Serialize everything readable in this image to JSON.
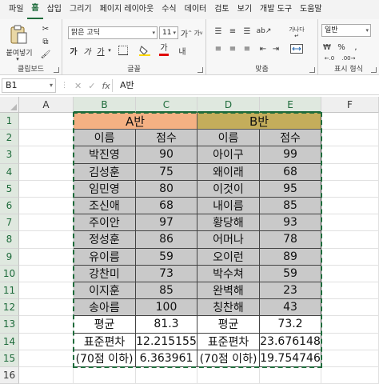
{
  "menu": [
    "파일",
    "홈",
    "삽입",
    "그리기",
    "페이지 레이아웃",
    "수식",
    "데이터",
    "검토",
    "보기",
    "개발 도구",
    "도움말"
  ],
  "menu_active_index": 1,
  "ribbon": {
    "paste_label": "붙여넣기",
    "clipboard_label": "클립보드",
    "font_name": "맑은 고딕",
    "font_size": "11",
    "font_label": "글꼴",
    "align_label": "맞춤",
    "number_format": "일반",
    "number_label": "표시 형식",
    "wrap_label": "가나다",
    "bold": "가",
    "italic": "가",
    "underline": "가",
    "font_color_glyph": "가",
    "grow_font": "가",
    "shrink_font": "가"
  },
  "formula_bar": {
    "name_box": "B1",
    "fx": "fx",
    "value": "A반"
  },
  "columns": [
    "A",
    "B",
    "C",
    "D",
    "E",
    "F"
  ],
  "rows": [
    "1",
    "2",
    "3",
    "4",
    "5",
    "6",
    "7",
    "8",
    "9",
    "10",
    "11",
    "12",
    "13",
    "14",
    "15",
    "16"
  ],
  "table": {
    "group_a": "A반",
    "group_b": "B반",
    "header": [
      "이름",
      "점수",
      "이름",
      "점수"
    ],
    "data": [
      [
        "박진영",
        "90",
        "아이구",
        "99"
      ],
      [
        "김성훈",
        "75",
        "왜이래",
        "68"
      ],
      [
        "임민영",
        "80",
        "이것이",
        "95"
      ],
      [
        "조신애",
        "68",
        "내이름",
        "85"
      ],
      [
        "주이안",
        "97",
        "황당해",
        "93"
      ],
      [
        "정성훈",
        "86",
        "어머나",
        "78"
      ],
      [
        "유이름",
        "59",
        "오이런",
        "89"
      ],
      [
        "강찬미",
        "73",
        "박수쳐",
        "59"
      ],
      [
        "이지훈",
        "85",
        "완벽해",
        "23"
      ],
      [
        "송아름",
        "100",
        "칭찬해",
        "43"
      ]
    ],
    "stats": [
      [
        "평균",
        "81.3",
        "평균",
        "73.2"
      ],
      [
        "표준편차",
        "12.215155",
        "표준편차",
        "23.676148"
      ],
      [
        "(70점 이하)",
        "6.363961",
        "(70점 이하)",
        "19.754746"
      ]
    ]
  },
  "colors": {
    "group_a_fill": "#f4b183",
    "group_b_fill": "#c4ad5b",
    "data_fill": "#c9c9c9",
    "accent": "#1e6b3b"
  }
}
